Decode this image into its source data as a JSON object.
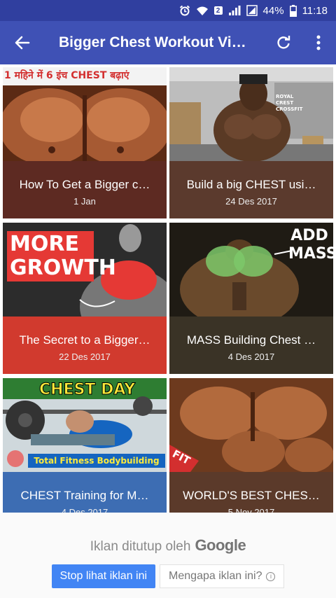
{
  "status_bar": {
    "battery": "44%",
    "time": "11:18",
    "badge": "2",
    "icons": [
      "alarm-icon",
      "wifi-icon",
      "signal-icon",
      "battery-icon"
    ]
  },
  "app_bar": {
    "title": "Bigger Chest Workout Vi…",
    "back_icon": "arrow-back-icon",
    "refresh_icon": "refresh-icon",
    "menu_icon": "more-vert-icon"
  },
  "videos": [
    {
      "title": "How To Get a Bigger c…",
      "date": "1 Jan",
      "caption_color": "#5d2a22",
      "overlay": "1 महिने में 6 इंच CHEST बढ़ाएं"
    },
    {
      "title": "Build a big CHEST usi…",
      "date": "24 Des 2017",
      "caption_color": "#5b3a2d",
      "overlay": "ROYAL CREST CROSSFIT"
    },
    {
      "title": "The Secret to a Bigger…",
      "date": "22 Des 2017",
      "caption_color": "#d13a2e",
      "overlay": "MORE GROWTH"
    },
    {
      "title": "MASS Building Chest …",
      "date": "4 Des 2017",
      "caption_color": "#3a3326",
      "overlay": "ADD MASS"
    },
    {
      "title": "CHEST Training for M…",
      "date": "4 Des 2017",
      "caption_color": "#3d6db3",
      "overlay": "CHEST DAY",
      "overlay2": "Total Fitness Bodybuilding"
    },
    {
      "title": "WORLD'S BEST CHES…",
      "date": "5 Nov 2017",
      "caption_color": "#5b3a2a",
      "overlay": "FIT"
    }
  ],
  "ad": {
    "closed_text": "Iklan ditutup oleh",
    "brand": "Google",
    "stop_label": "Stop lihat iklan ini",
    "why_label": "Mengapa iklan ini?",
    "info_icon": "info-icon"
  }
}
